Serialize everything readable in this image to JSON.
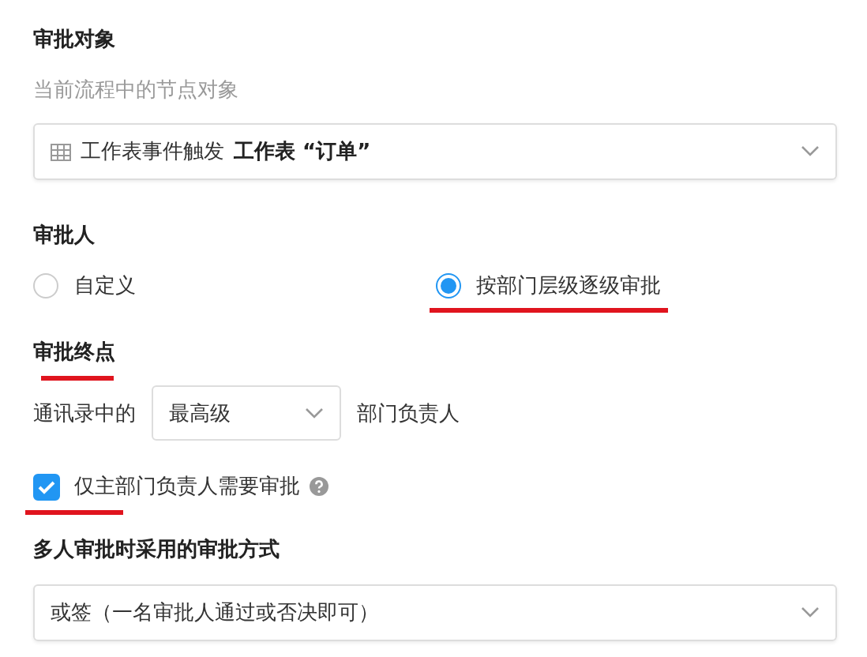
{
  "approval_object": {
    "title": "审批对象",
    "subtitle": "当前流程中的节点对象",
    "select": {
      "prefix": "工作表事件触发",
      "value": "工作表 “订单”"
    }
  },
  "approver": {
    "title": "审批人",
    "options": [
      {
        "label": "自定义",
        "selected": false,
        "underlined": false
      },
      {
        "label": "按部门层级逐级审批",
        "selected": true,
        "underlined": true
      }
    ]
  },
  "endpoint": {
    "title": "审批终点",
    "underlined": true,
    "prefix": "通讯录中的",
    "select": "最高级",
    "suffix": "部门负责人"
  },
  "main_dept_only": {
    "label": "仅主部门负责人需要审批",
    "checked": true,
    "underlined": true
  },
  "method": {
    "title": "多人审批时采用的审批方式",
    "select": "或签（一名审批人通过或否决即可）"
  }
}
